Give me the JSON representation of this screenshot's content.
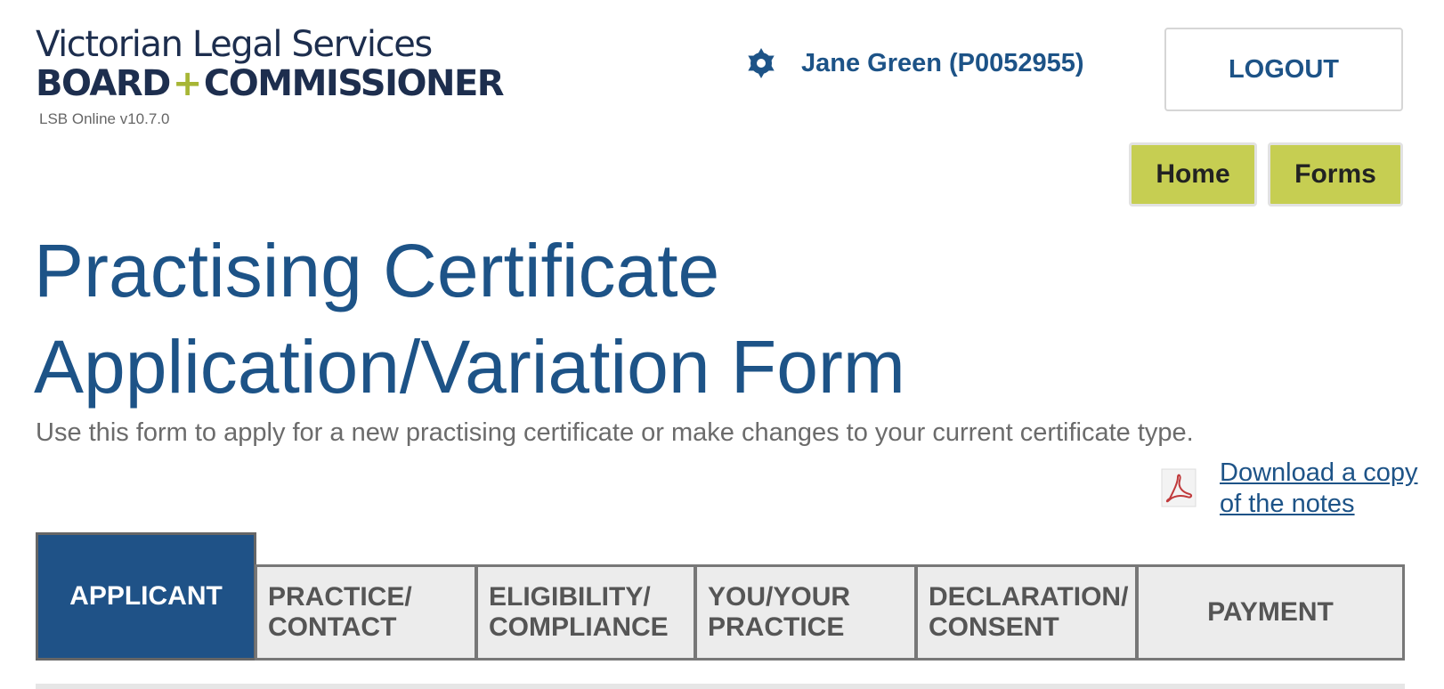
{
  "header": {
    "logo_line1": "Victorian Legal Services",
    "logo_line2_left": "BOARD",
    "logo_line2_plus": "+",
    "logo_line2_right": "COMMISSIONER",
    "version": "LSB Online v10.7.0",
    "user_name": "Jane Green (P0052955)",
    "logout_label": "LOGOUT",
    "nav": {
      "home_label": "Home",
      "forms_label": "Forms"
    }
  },
  "main": {
    "title": "Practising Certificate Application/Variation Form",
    "subtitle": "Use this form to apply for a new practising certificate or make changes to your current certificate type.",
    "download_link": "Download a copy of the notes"
  },
  "tabs": [
    {
      "label": "APPLICANT",
      "active": true
    },
    {
      "label": "PRACTICE/ CONTACT",
      "active": false
    },
    {
      "label": "ELIGIBILITY/ COMPLIANCE",
      "active": false
    },
    {
      "label": "YOU/YOUR PRACTICE",
      "active": false
    },
    {
      "label": "DECLARATION/ CONSENT",
      "active": false
    },
    {
      "label": "PAYMENT",
      "active": false
    }
  ],
  "colors": {
    "brand_blue": "#1d5387",
    "active_tab": "#1f5287",
    "nav_green": "#c6ce52",
    "logo_plus": "#a7b635"
  },
  "icons": {
    "settings": "gear-icon",
    "pdf": "pdf-icon"
  }
}
